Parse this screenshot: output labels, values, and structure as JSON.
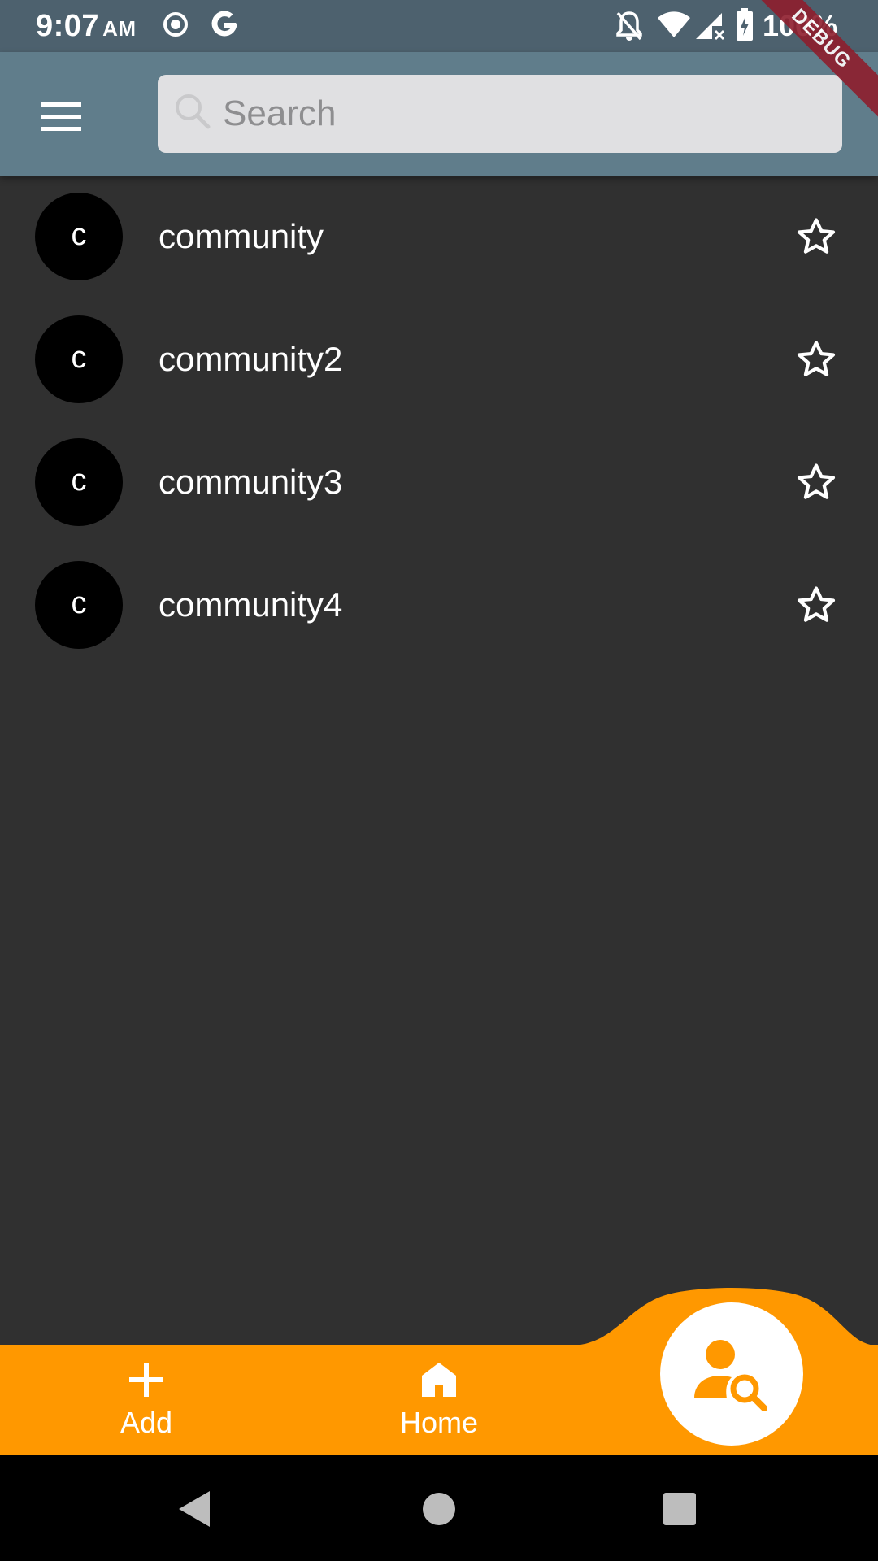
{
  "status_bar": {
    "time": "9:07",
    "ampm": "AM",
    "battery": "100%"
  },
  "debug_banner": "DEBUG",
  "search": {
    "placeholder": "Search",
    "value": ""
  },
  "communities": [
    {
      "avatar_letter": "c",
      "name": "community"
    },
    {
      "avatar_letter": "c",
      "name": "community2"
    },
    {
      "avatar_letter": "c",
      "name": "community3"
    },
    {
      "avatar_letter": "c",
      "name": "community4"
    }
  ],
  "bottom_nav": {
    "add_label": "Add",
    "home_label": "Home"
  },
  "colors": {
    "status_bar": "#4d616e",
    "app_bar": "#607d8b",
    "background": "#303030",
    "accent": "#ff9800",
    "search_bg": "#e0e0e2"
  },
  "icons": {
    "menu": "menu-icon",
    "search": "search-icon",
    "favorite": "star-outline-icon",
    "add": "plus-icon",
    "home": "home-icon",
    "fab": "person-search-icon"
  }
}
